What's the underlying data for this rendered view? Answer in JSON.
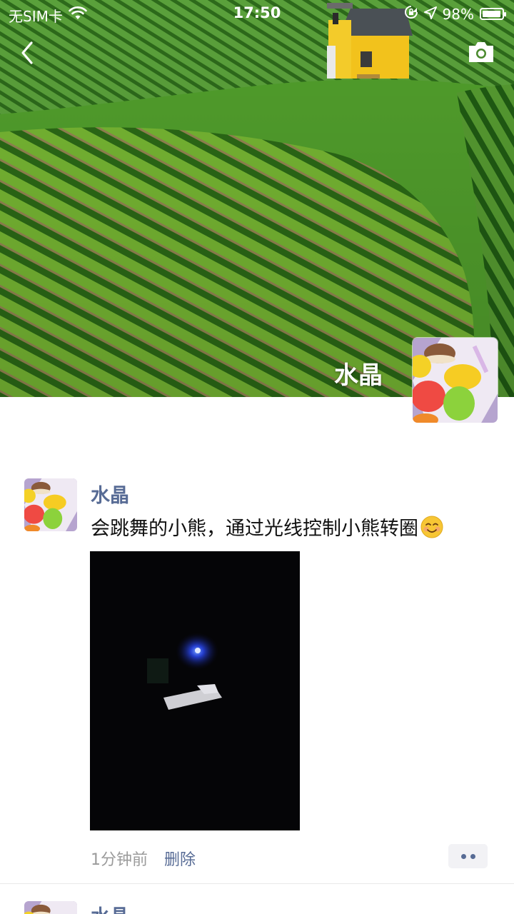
{
  "status_bar": {
    "carrier": "无SIM卡",
    "time": "17:50",
    "battery": "98%",
    "battery_level": 0.98
  },
  "header": {
    "back_icon": "chevron-left-icon",
    "camera_icon": "camera-icon"
  },
  "profile": {
    "name": "水晶"
  },
  "posts": [
    {
      "author": "水晶",
      "text": "会跳舞的小熊，通过光线控制小熊转圈",
      "emoji": "smiling-face-icon",
      "time": "1分钟前",
      "delete_label": "删除",
      "more_icon": "more-dots-icon"
    },
    {
      "author": "水晶"
    }
  ],
  "colors": {
    "link": "#576b95",
    "time": "#9b9b9b",
    "text": "#111111"
  }
}
